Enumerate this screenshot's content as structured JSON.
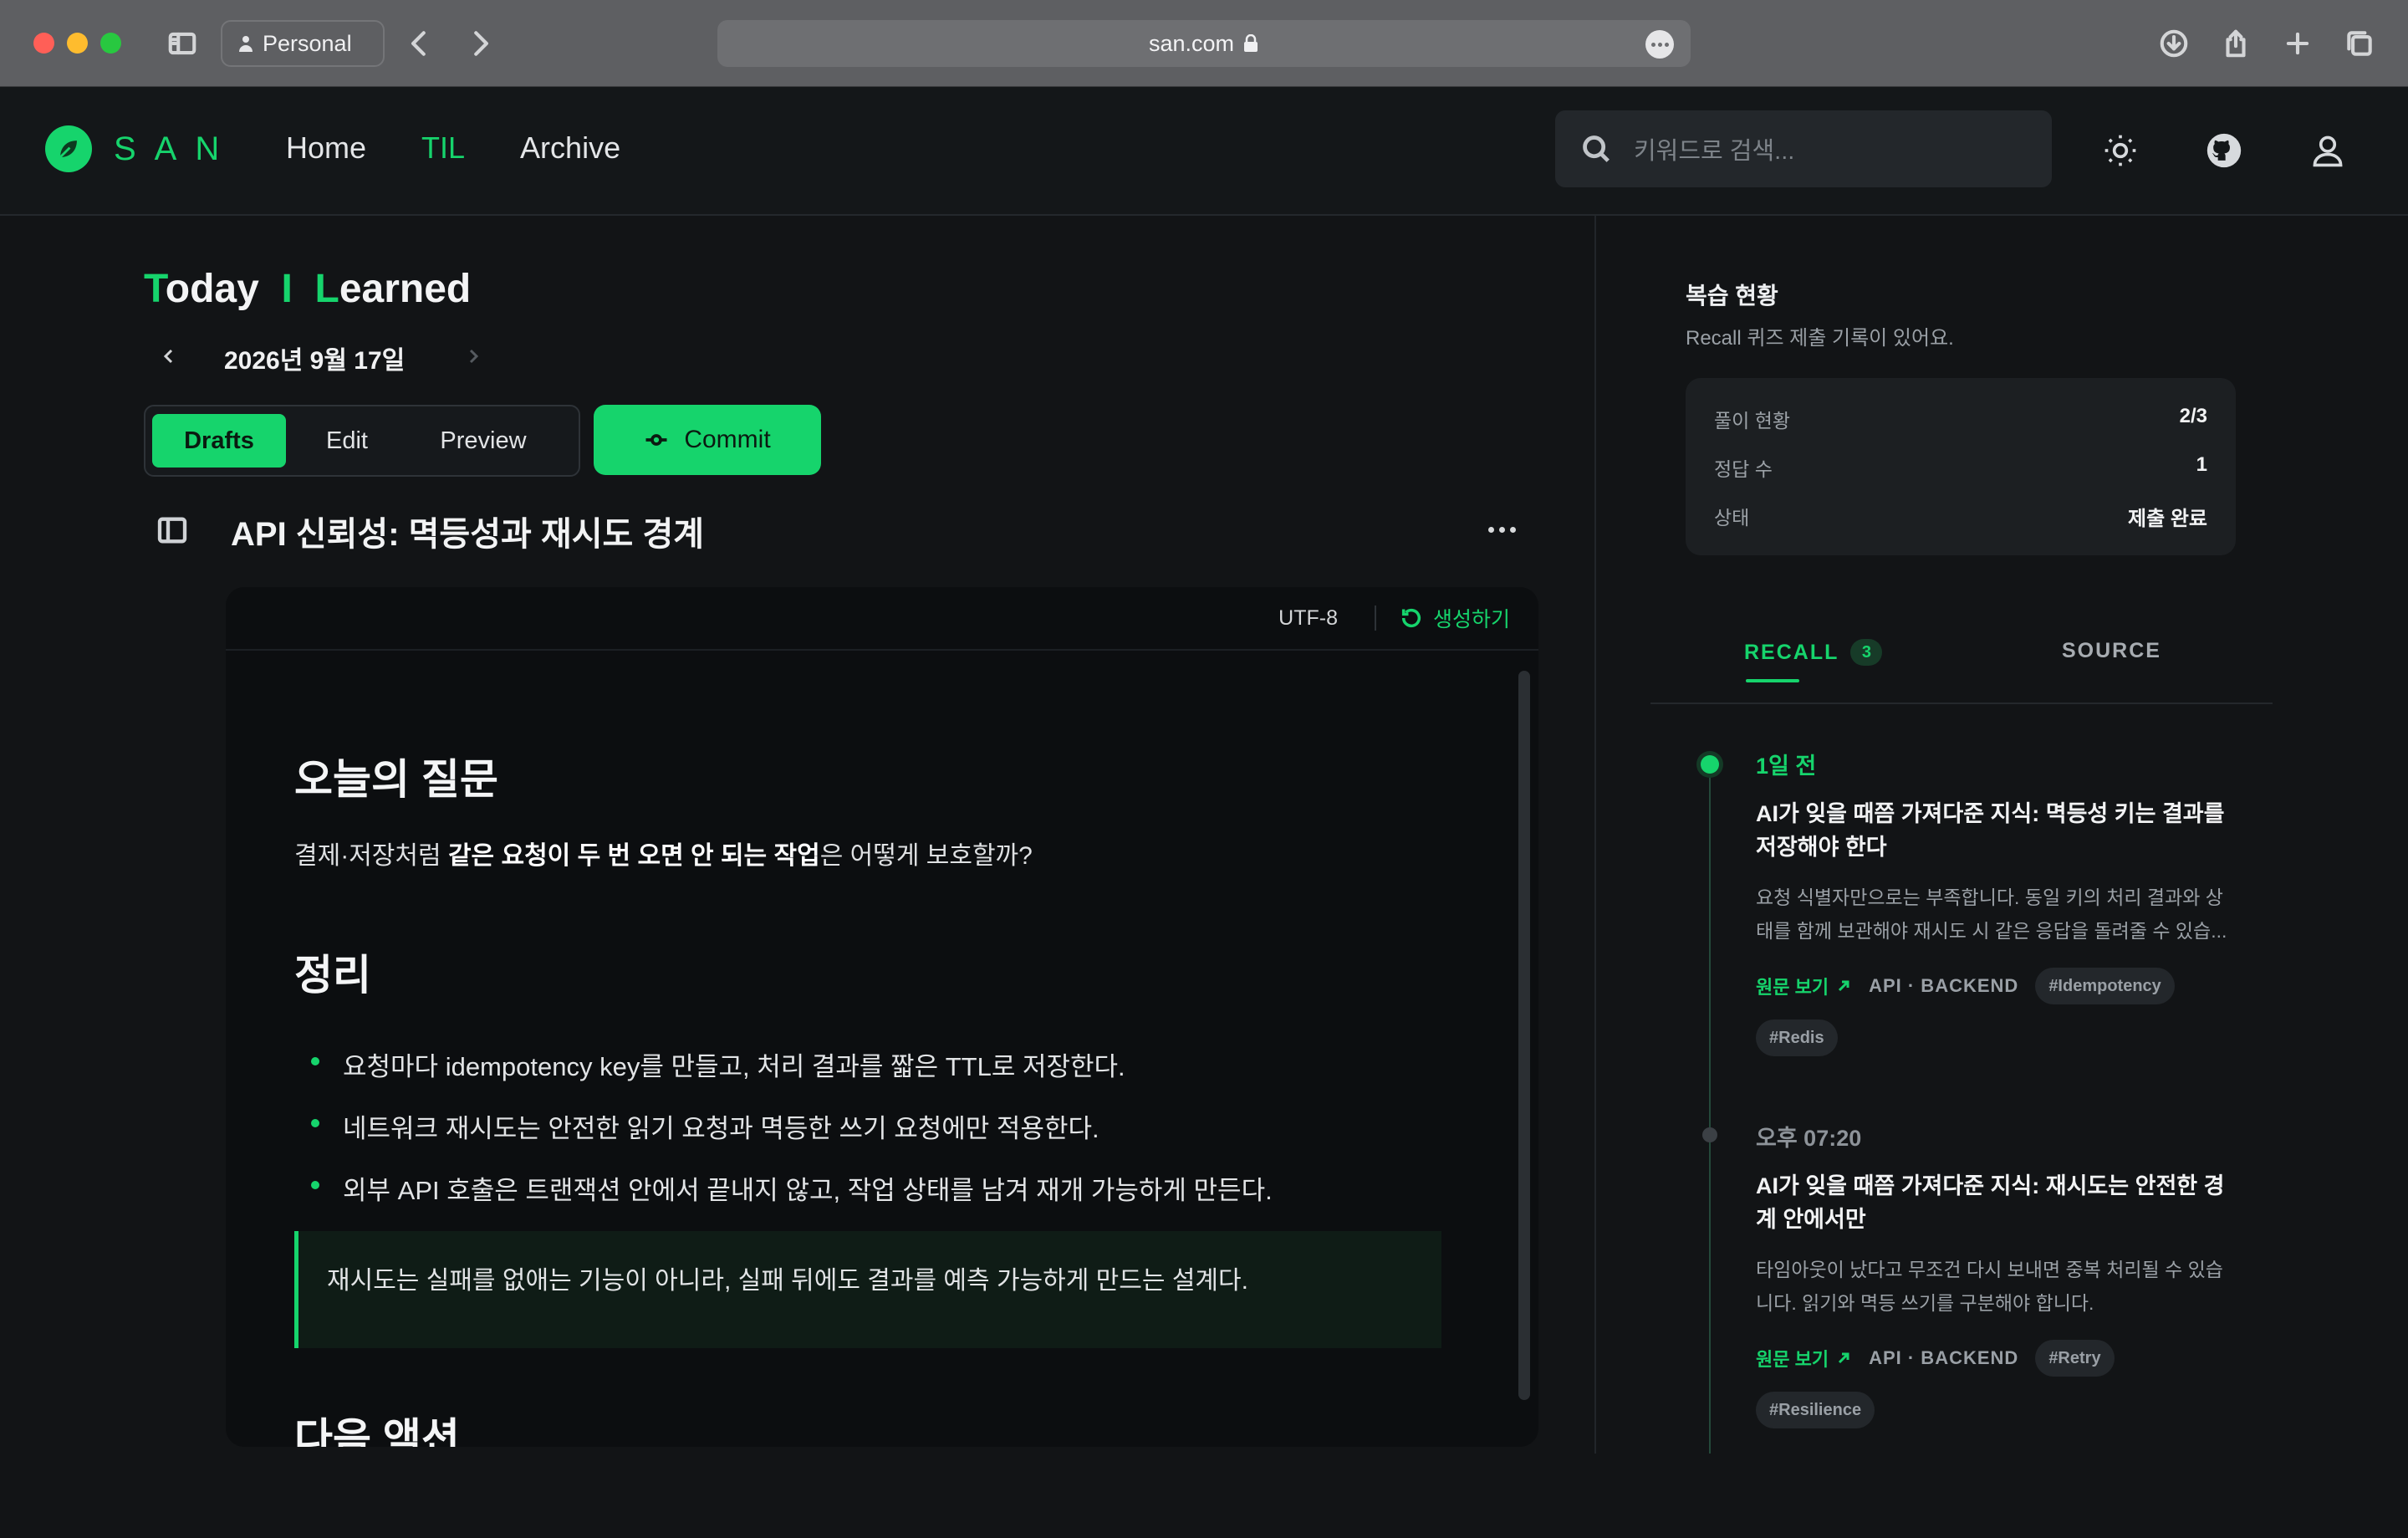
{
  "browser": {
    "profile_label": "Personal",
    "url": "san.com"
  },
  "header": {
    "logo_text": "SAN",
    "nav": [
      {
        "label": "Home"
      },
      {
        "label": "TIL"
      },
      {
        "label": "Archive"
      }
    ],
    "active_nav": "TIL",
    "search_placeholder": "키워드로 검색..."
  },
  "main": {
    "title": {
      "t": "T",
      "oday": "oday",
      "i": "I",
      "l": "L",
      "earned": "earned"
    },
    "date": "2026년 9월 17일",
    "modes": [
      "Drafts",
      "Edit",
      "Preview"
    ],
    "active_mode": "Drafts",
    "commit_label": "Commit",
    "doc_title": "API 신뢰성: 멱등성과 재시도 경계",
    "editor": {
      "encoding": "UTF-8",
      "regenerate_label": "생성하기"
    },
    "doc": {
      "h_question": "오늘의 질문",
      "question_pre": "결제·저장처럼 ",
      "question_bold": "같은 요청이 두 번 오면 안 되는 작업",
      "question_post": "은 어떻게 보호할까?",
      "h_summary": "정리",
      "bullets": [
        "요청마다 idempotency key를 만들고, 처리 결과를 짧은 TTL로 저장한다.",
        "네트워크 재시도는 안전한 읽기 요청과 멱등한 쓰기 요청에만 적용한다.",
        "외부 API 호출은 트랜잭션 안에서 끝내지 않고, 작업 상태를 남겨 재개 가능하게 만든다."
      ],
      "quote": "재시도는 실패를 없애는 기능이 아니라, 실패 뒤에도 결과를 예측 가능하게 만드는 설계다.",
      "h_next": "다음 액션"
    }
  },
  "sidebar": {
    "title": "복습 현황",
    "subtitle": "Recall 퀴즈 제출 기록이 있어요.",
    "stats": [
      {
        "label": "풀이 현황",
        "value": "2/3"
      },
      {
        "label": "정답 수",
        "value": "1"
      },
      {
        "label": "상태",
        "value": "제출 완료"
      }
    ],
    "tabs": [
      {
        "label": "RECALL",
        "count": "3"
      },
      {
        "label": "SOURCE"
      }
    ],
    "entries": [
      {
        "time": "1일 전",
        "title": "AI가 잊을 때쯤 가져다준 지식: 멱등성 키는 결과를 저장해야 한다",
        "body": "요청 식별자만으로는 부족합니다. 동일 키의 처리 결과와 상태를 함께 보관해야 재시도 시 같은 응답을 돌려줄 수 있습...",
        "link": "원문 보기",
        "category": "API · BACKEND",
        "tags": [
          "#Idempotency",
          "#Redis"
        ]
      },
      {
        "time": "오후 07:20",
        "title": "AI가 잊을 때쯤 가져다준 지식: 재시도는 안전한 경계 안에서만",
        "body": "타임아웃이 났다고 무조건 다시 보내면 중복 처리될 수 있습니다. 읽기와 멱등 쓰기를 구분해야 합니다.",
        "link": "원문 보기",
        "category": "API · BACKEND",
        "tags": [
          "#Retry",
          "#Resilience"
        ]
      }
    ]
  },
  "colors": {
    "accent": "#16d46c",
    "background": "#121416",
    "editor_bg": "#0c0e10"
  }
}
